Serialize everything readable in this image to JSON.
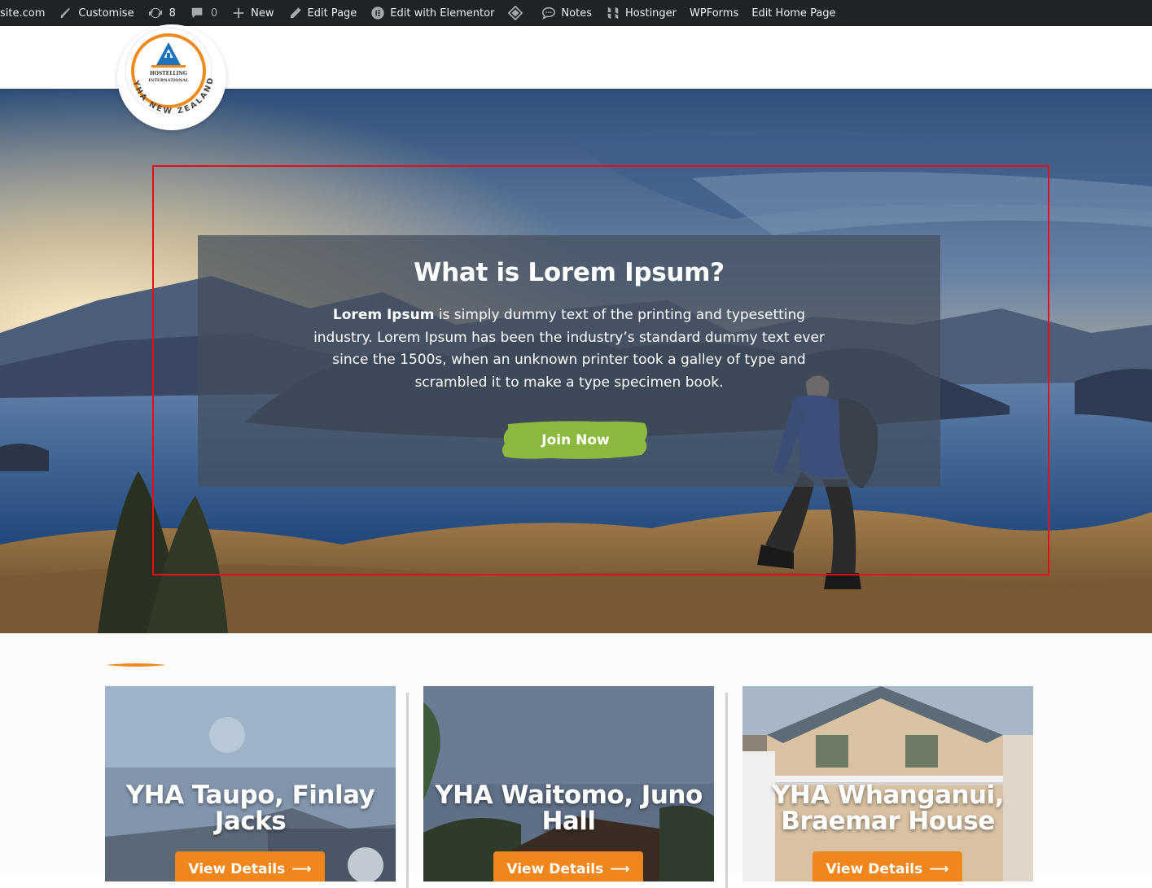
{
  "admin_bar": {
    "site": "site.com",
    "customise": "Customise",
    "updates_count": "8",
    "comments_count": "0",
    "new": "New",
    "edit_page": "Edit Page",
    "edit_elementor": "Edit with Elementor",
    "notes": "Notes",
    "hostinger": "Hostinger",
    "wpforms": "WPForms",
    "edit_home": "Edit Home Page"
  },
  "logo": {
    "line1": "HOSTELLING",
    "line2": "INTERNATIONAL",
    "arc": "YHA NEW ZEALAND"
  },
  "hero": {
    "title": "What is Lorem Ipsum?",
    "text_strong": "Lorem Ipsum",
    "text_body": " is simply dummy text of the printing and typesetting industry. Lorem Ipsum has been the industry’s standard dummy text ever since the 1500s, when an unknown printer took a galley of type and scrambled it to make a type specimen book.",
    "button": "Join Now"
  },
  "cards": [
    {
      "title": "YHA Taupo, Finlay Jacks",
      "button": "View Details"
    },
    {
      "title": "YHA Waitomo, Juno Hall",
      "button": "View Details"
    },
    {
      "title": "YHA Whanganui, Braemar House",
      "button": "View Details"
    }
  ],
  "colors": {
    "admin_bar": "#1d2327",
    "button_green": "#8db83f",
    "button_orange": "#f0861c",
    "selection_red": "#e3101b",
    "logo_orange": "#f08a1c",
    "logo_blue": "#1e73be"
  }
}
